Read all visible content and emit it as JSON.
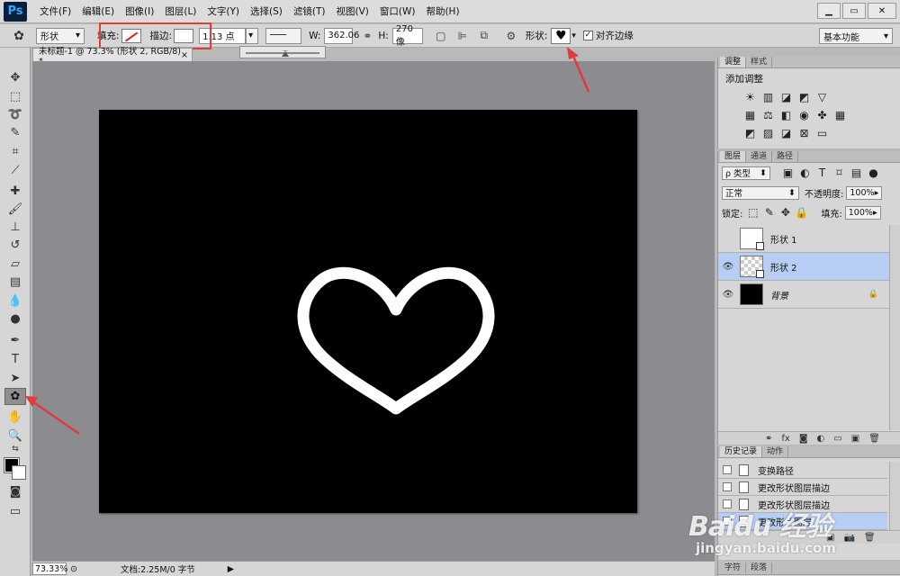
{
  "app": {
    "logo": "Ps"
  },
  "menu": [
    "文件(F)",
    "编辑(E)",
    "图像(I)",
    "图层(L)",
    "文字(Y)",
    "选择(S)",
    "滤镜(T)",
    "视图(V)",
    "窗口(W)",
    "帮助(H)"
  ],
  "window_controls": {
    "minimize": "▁",
    "restore": "▭",
    "close": "✕"
  },
  "options": {
    "mode": "形状",
    "fill_label": "填充:",
    "stroke_label": "描边:",
    "stroke_width": "1.13 点",
    "w_label": "W:",
    "w_value": "362.06",
    "h_label": "H:",
    "h_value": "270 像",
    "shape_label": "形状:",
    "shape_glyph": "♥",
    "align_edges": "对齐边缘",
    "align_checked": "✓",
    "workspace": "基本功能"
  },
  "document": {
    "tab_title": "未标题-1 @ 73.3% (形状 2, RGB/8) *",
    "close": "×"
  },
  "status": {
    "zoom": "73.33%",
    "doc_info": "文档:2.25M/0 字节"
  },
  "adjustments": {
    "tabs": [
      "调整",
      "样式"
    ],
    "title": "添加调整"
  },
  "layers": {
    "tabs": [
      "图层",
      "通道",
      "路径"
    ],
    "filter": "ρ 类型",
    "blend_mode": "正常",
    "opacity_label": "不透明度:",
    "opacity": "100%",
    "lock_label": "锁定:",
    "fill_label": "填充:",
    "fill": "100%",
    "items": [
      {
        "name": "形状 1",
        "visible": false
      },
      {
        "name": "形状 2",
        "visible": true
      },
      {
        "name": "背景",
        "visible": true
      }
    ]
  },
  "history": {
    "tabs": [
      "历史记录",
      "动作"
    ],
    "items": [
      "变换路径",
      "更改形状图层描边",
      "更改形状图层描边",
      "更改形状图层"
    ]
  },
  "bottom_tabs": [
    "字符",
    "段落"
  ],
  "watermark": {
    "main": "Baidu 经验",
    "sub": "jingyan.baidu.com"
  },
  "colors": {
    "accent_red": "#e03c3c",
    "selection_blue": "#b7cdf3",
    "canvas_bg": "#000000",
    "heart_stroke": "#ffffff"
  }
}
